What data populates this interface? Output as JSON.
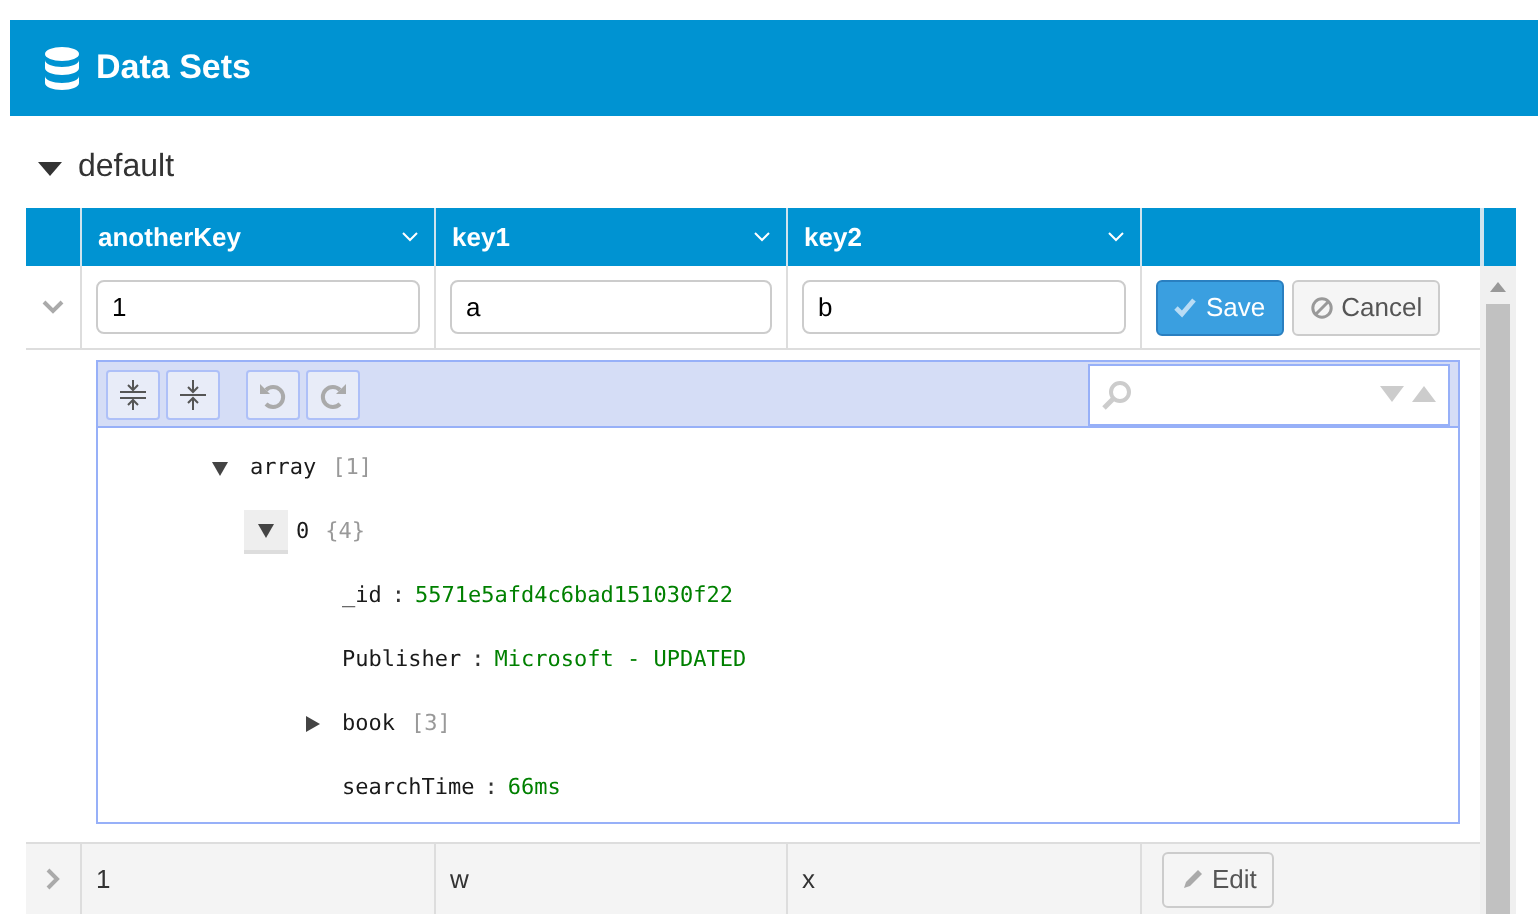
{
  "title": "Data Sets",
  "group": {
    "label": "default",
    "expanded": true
  },
  "columns": [
    "anotherKey",
    "key1",
    "key2"
  ],
  "rows": [
    {
      "expanded": true,
      "editing": true,
      "cells": [
        "1",
        "a",
        "b"
      ],
      "buttons": [
        {
          "label": "Save",
          "kind": "save"
        },
        {
          "label": "Cancel",
          "kind": "cancel"
        }
      ],
      "editor": {
        "tree": [
          {
            "kind": "branch",
            "key": "array",
            "summary": "[1]",
            "expanded": true,
            "focused": false,
            "children": [
              {
                "kind": "branch",
                "key": "0",
                "summary": "{4}",
                "expanded": true,
                "focused": true,
                "children": [
                  {
                    "kind": "value",
                    "key": "_id",
                    "separator": ":",
                    "value": "5571e5afd4c6bad151030f22"
                  },
                  {
                    "kind": "value",
                    "key": "Publisher",
                    "separator": ":",
                    "value": "Microsoft - UPDATED"
                  },
                  {
                    "kind": "branch",
                    "key": "book",
                    "summary": "[3]",
                    "expanded": false,
                    "focused": false
                  },
                  {
                    "kind": "value",
                    "key": "searchTime",
                    "separator": ":",
                    "value": "66ms"
                  }
                ]
              }
            ]
          }
        ]
      }
    },
    {
      "expanded": false,
      "editing": false,
      "cells": [
        "1",
        "w",
        "x"
      ],
      "buttons": [
        {
          "label": "Edit",
          "kind": "edit"
        }
      ]
    }
  ]
}
